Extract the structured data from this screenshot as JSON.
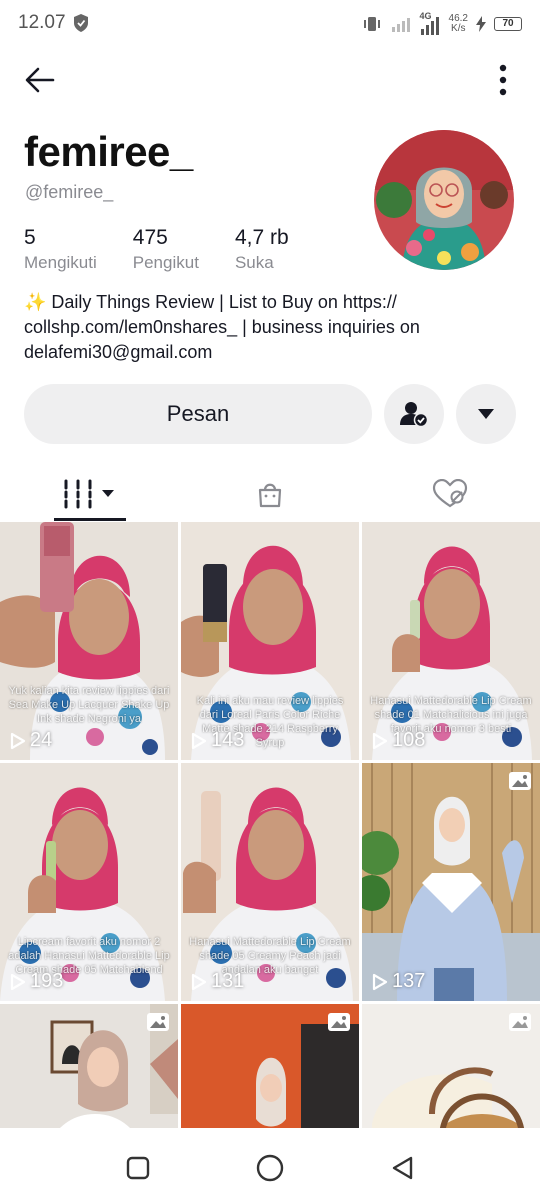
{
  "status_bar": {
    "time": "12.07",
    "net_speed_value": "46.2",
    "net_speed_unit": "K/s",
    "network_type": "4G",
    "battery": "70"
  },
  "profile": {
    "display_name": "femiree_",
    "username": "@femiree_",
    "bio": "✨ Daily Things Review | List to Buy on https:// collshp.com/lem0nshares_ | business inquiries on delafemi30@gmail.com",
    "stats": [
      {
        "value": "5",
        "label": "Mengikuti"
      },
      {
        "value": "475",
        "label": "Pengikut"
      },
      {
        "value": "4,7 rb",
        "label": "Suka"
      }
    ]
  },
  "actions": {
    "message_label": "Pesan"
  },
  "grid": {
    "items": [
      {
        "views": "24",
        "caption": "Yuk kalian kita review lippies dari Sea Make Up Lacquer Shake Up Ink shade Negroni ya"
      },
      {
        "views": "143",
        "caption": "Kali ini aku mau review lippies dari Loreal Paris Color Riche Matte shade 214 Raspberry Syrup"
      },
      {
        "views": "108",
        "caption": "Hanasui Mattedorable Lip Cream shade 01 Matchalicious ini juga favorit aku nomor 3 besti"
      },
      {
        "views": "193",
        "caption": "Lipcream favorit aku nomor 2 adalah Hanasui Mattedorable Lip Cream shade 05 Matchablend"
      },
      {
        "views": "131",
        "caption": "Hanasui Mattedorable Lip Cream shade 05 Creamy Peach jadi andalan aku banget"
      },
      {
        "views": "137",
        "caption": ""
      }
    ]
  },
  "colors": {
    "text_primary": "#161823",
    "text_secondary": "#8a8b91",
    "button_bg": "#efeff0",
    "hijab_pink": "#d63a6b"
  }
}
